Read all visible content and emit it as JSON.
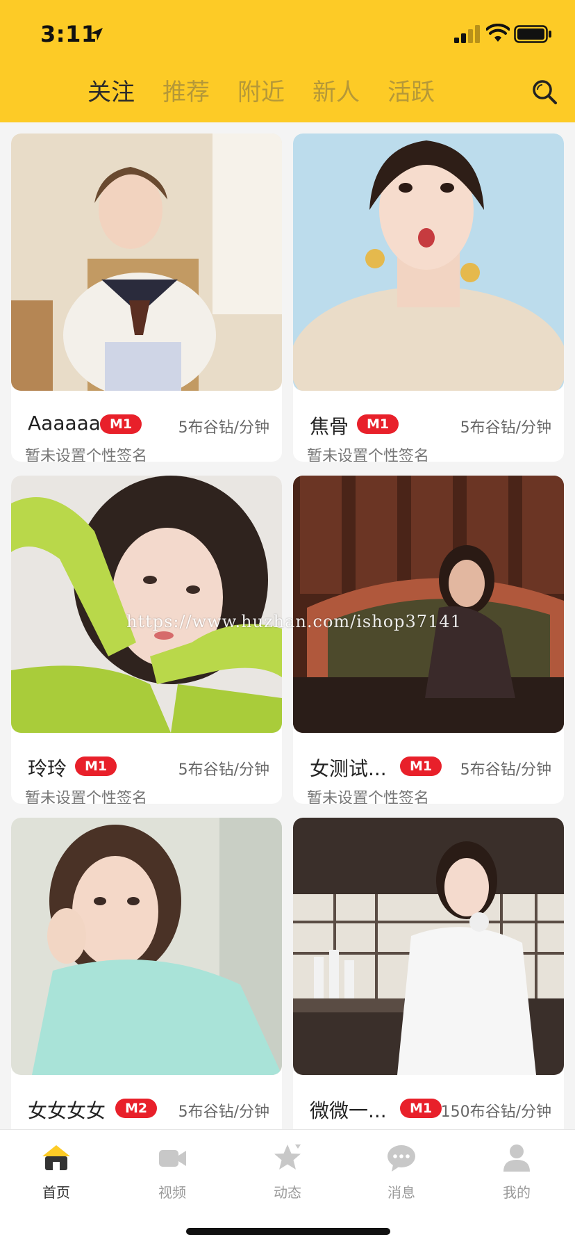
{
  "status_bar": {
    "time": "3:11"
  },
  "top_tabs": [
    {
      "label": "关注",
      "active": true
    },
    {
      "label": "推荐",
      "active": false
    },
    {
      "label": "附近",
      "active": false
    },
    {
      "label": "新人",
      "active": false
    },
    {
      "label": "活跃",
      "active": false
    }
  ],
  "search": {
    "icon": "search-icon"
  },
  "cards": [
    {
      "name": "Aaaaaa",
      "badge": "M1",
      "rate": "5布谷钻/分钟",
      "signature": "暂未设置个性签名"
    },
    {
      "name": "焦骨",
      "badge": "M1",
      "rate": "5布谷钻/分钟",
      "signature": "暂未设置个性签名"
    },
    {
      "name": "玲玲",
      "badge": "M1",
      "rate": "5布谷钻/分钟",
      "signature": "暂未设置个性签名"
    },
    {
      "name": "女测试...",
      "badge": "M1",
      "rate": "5布谷钻/分钟",
      "signature": "暂未设置个性签名"
    },
    {
      "name": "女女女女",
      "badge": "M2",
      "rate": "5布谷钻/分钟",
      "signature": ""
    },
    {
      "name": "微微一...",
      "badge": "M1",
      "rate": "150布谷钻/分钟",
      "signature": ""
    }
  ],
  "watermark": "https://www.huzhan.com/ishop37141",
  "bottom_nav": [
    {
      "label": "首页",
      "icon": "home-icon",
      "active": true
    },
    {
      "label": "视频",
      "icon": "video-camera-icon",
      "active": false
    },
    {
      "label": "动态",
      "icon": "star-icon",
      "active": false
    },
    {
      "label": "消息",
      "icon": "chat-bubble-icon",
      "active": false
    },
    {
      "label": "我的",
      "icon": "person-icon",
      "active": false
    }
  ],
  "colors": {
    "header_bg": "#FDCB26",
    "badge_red": "#E8202A",
    "active_text": "#2b2b2b",
    "inactive_tab": "#b59838",
    "inactive_nav": "#9a9a9a"
  }
}
